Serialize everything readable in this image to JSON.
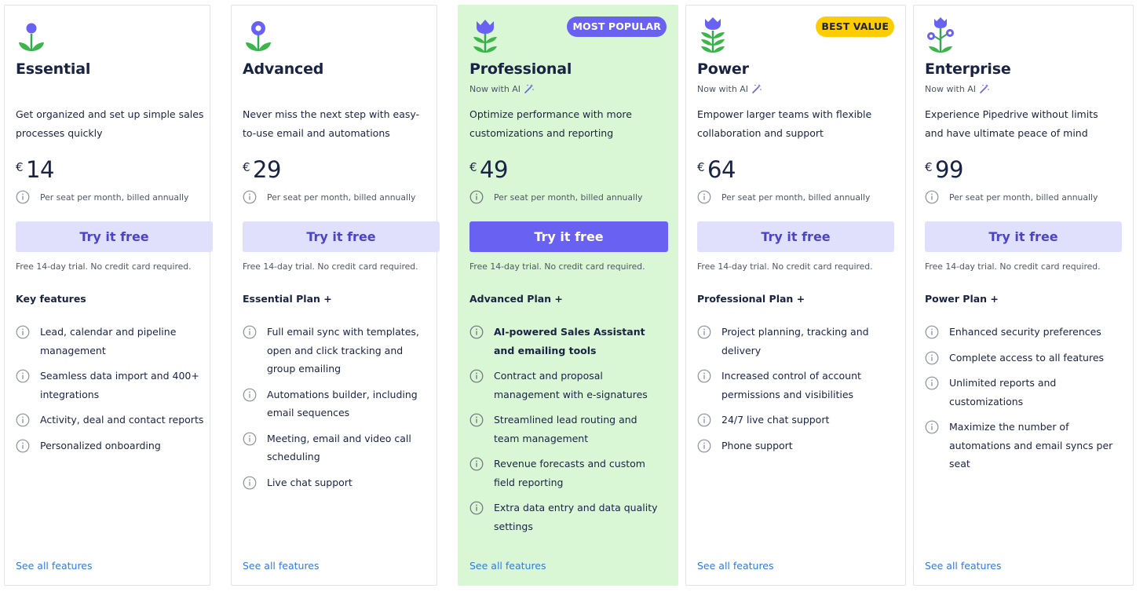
{
  "colors": {
    "accent": "#6861f2",
    "highlight_bg": "#d9f7d5",
    "best_value": "#ffcc00",
    "link": "#317ae2",
    "button_soft_bg": "#e1e0fc"
  },
  "plans": [
    {
      "id": "essential",
      "name": "Essential",
      "badge": "",
      "ai_tag": "",
      "description": "Get organized and set up simple sales processes quickly",
      "currency": "€",
      "price": "14",
      "billing_note": "Per seat per month, billed annually",
      "cta_label": "Try it free",
      "trial_note": "Free 14-day trial. No credit card required.",
      "features_heading": "Key features",
      "features": [
        "Lead, calendar and pipeline management",
        "Seamless data import and 400+ integrations",
        "Activity, deal and contact reports",
        "Personalized onboarding"
      ],
      "see_all_label": "See all features",
      "icon": "flower-one-bloom-icon"
    },
    {
      "id": "advanced",
      "name": "Advanced",
      "badge": "",
      "ai_tag": "",
      "description": "Never miss the next step with easy-to-use email and automations",
      "currency": "€",
      "price": "29",
      "billing_note": "Per seat per month, billed annually",
      "cta_label": "Try it free",
      "trial_note": "Free 14-day trial. No credit card required.",
      "features_heading": "Essential Plan +",
      "features": [
        "Full email sync with templates, open and click tracking and group emailing",
        "Automations builder, including email sequences",
        "Meeting, email and video call scheduling",
        "Live chat support"
      ],
      "see_all_label": "See all features",
      "icon": "flower-open-bloom-icon"
    },
    {
      "id": "professional",
      "name": "Professional",
      "badge": "MOST POPULAR",
      "ai_tag": "Now with AI",
      "description": "Optimize performance with more customizations and reporting",
      "currency": "€",
      "price": "49",
      "billing_note": "Per seat per month, billed annually",
      "cta_label": "Try it free",
      "trial_note": "Free 14-day trial. No credit card required.",
      "features_heading": "Advanced Plan +",
      "features": [
        "AI-powered Sales Assistant and emailing tools",
        "Contract and proposal management with e-signatures",
        "Streamlined lead routing and team management",
        "Revenue forecasts and custom field reporting",
        "Extra data entry and data quality settings"
      ],
      "see_all_label": "See all features",
      "icon": "flower-tulip-icon"
    },
    {
      "id": "power",
      "name": "Power",
      "badge": "BEST VALUE",
      "ai_tag": "Now with AI",
      "description": "Empower larger teams with flexible collaboration and support",
      "currency": "€",
      "price": "64",
      "billing_note": "Per seat per month, billed annually",
      "cta_label": "Try it free",
      "trial_note": "Free 14-day trial. No credit card required.",
      "features_heading": "Professional Plan +",
      "features": [
        "Project planning, tracking and delivery",
        "Increased control of account permissions and visibilities",
        "24/7 live chat support",
        "Phone support"
      ],
      "see_all_label": "See all features",
      "icon": "flower-tall-tulip-icon"
    },
    {
      "id": "enterprise",
      "name": "Enterprise",
      "badge": "",
      "ai_tag": "Now with AI",
      "description": "Experience Pipedrive without limits and have ultimate peace of mind",
      "currency": "€",
      "price": "99",
      "billing_note": "Per seat per month, billed annually",
      "cta_label": "Try it free",
      "trial_note": "Free 14-day trial. No credit card required.",
      "features_heading": "Power Plan +",
      "features": [
        "Enhanced security preferences",
        "Complete access to all features",
        "Unlimited reports and customizations",
        "Maximize the number of automations and email syncs per seat"
      ],
      "see_all_label": "See all features",
      "icon": "flower-bouquet-icon"
    }
  ]
}
